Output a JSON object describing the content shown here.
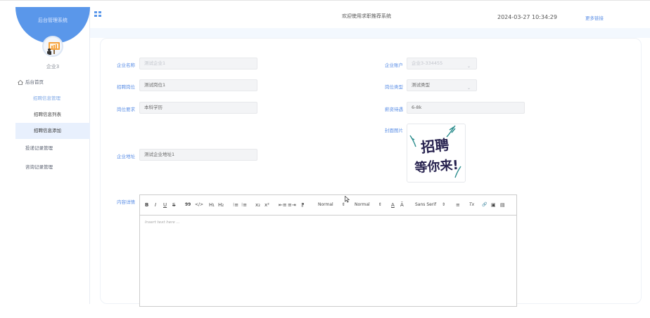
{
  "sidebar": {
    "title": "后台管理系统",
    "username": "企业3",
    "menu": {
      "home": "后台首页",
      "recruit_group": "招聘信息管理",
      "recruit_list": "招聘信息列表",
      "recruit_add": "招聘信息添加",
      "delivery": "投递记录管理",
      "consult": "咨询记录管理"
    }
  },
  "header": {
    "title": "欢迎使用求职推荐系统",
    "datetime": "2024-03-27 10:34:29",
    "more_link": "更多链接"
  },
  "form": {
    "company_name": {
      "label": "企业名称",
      "value": "测试企业1"
    },
    "company_account": {
      "label": "企业账户",
      "value": "企业3-334455"
    },
    "position": {
      "label": "招聘岗位",
      "value": "测试岗位1"
    },
    "position_type": {
      "label": "岗位类型",
      "value": "测试类型"
    },
    "requirement": {
      "label": "岗位要求",
      "value": "本科学历"
    },
    "salary": {
      "label": "薪资待遇",
      "value": "6-8k"
    },
    "cover": {
      "label": "封面图片",
      "line1": "招聘",
      "line2": "等你来!"
    },
    "address": {
      "label": "企业地址",
      "value": "测试企业地址1"
    },
    "content": {
      "label": "内容详情"
    }
  },
  "editor": {
    "toolbar": {
      "bold": "B",
      "italic": "I",
      "underline": "U",
      "strike": "S",
      "quote": "99",
      "code": "</>",
      "h1": "H₁",
      "h2": "H₂",
      "ol": "⁝≡",
      "ul": "⁝≡",
      "sub": "x₂",
      "sup": "x²",
      "outdent": "⇤≡",
      "indent": "≡⇥",
      "direction": "⁋",
      "size": "Normal",
      "header": "Normal",
      "color": "A",
      "bg": "Ā",
      "font": "Sans Serif",
      "align": "≡",
      "clean": "Tx",
      "link": "🔗",
      "image": "▣",
      "video": "▤"
    },
    "placeholder": "Insert text here ..."
  },
  "colors": {
    "accent": "#5a97ea",
    "link": "#5a8ee6"
  }
}
